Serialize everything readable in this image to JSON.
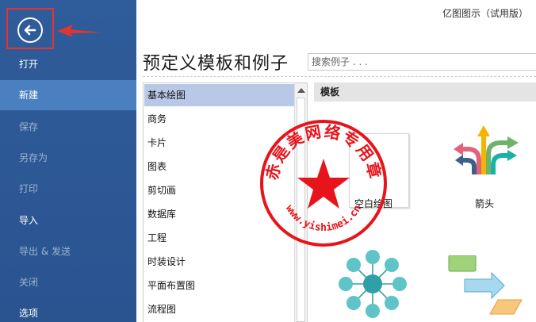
{
  "app_title": "亿图图示（试用版）",
  "sidebar": {
    "items": [
      {
        "label": "打开",
        "dim": false
      },
      {
        "label": "新建",
        "dim": false,
        "active": true
      },
      {
        "label": "保存",
        "dim": true
      },
      {
        "label": "另存为",
        "dim": true
      },
      {
        "label": "打印",
        "dim": true
      },
      {
        "label": "导入",
        "dim": false
      },
      {
        "label": "导出 & 发送",
        "dim": true
      },
      {
        "label": "关闭",
        "dim": true
      },
      {
        "label": "选项",
        "dim": false
      }
    ]
  },
  "main": {
    "title": "预定义模板和例子",
    "search_placeholder": "搜索例子 . . .",
    "categories": [
      "基本绘图",
      "商务",
      "卡片",
      "图表",
      "剪切画",
      "数据库",
      "工程",
      "时装设计",
      "平面布置图",
      "流程图"
    ],
    "selected_category": "基本绘图",
    "templates_header": "模板",
    "templates": [
      {
        "label": "空白绘图",
        "icon": "blank-page-icon"
      },
      {
        "label": "箭头",
        "icon": "arrows-icon"
      },
      {
        "label": "",
        "icon": "mind-map-icon"
      },
      {
        "label": "",
        "icon": "flowchart-shapes-icon"
      }
    ]
  },
  "stamp": {
    "top_text": "赤是美网络专用章",
    "bottom_text": "www.yishimei.cn",
    "color": "#e8141b"
  },
  "colors": {
    "sidebar": "#2b5797",
    "active_item": "#4a7fc0",
    "selected_category": "#b8c8e6",
    "annotation": "#e53333"
  }
}
